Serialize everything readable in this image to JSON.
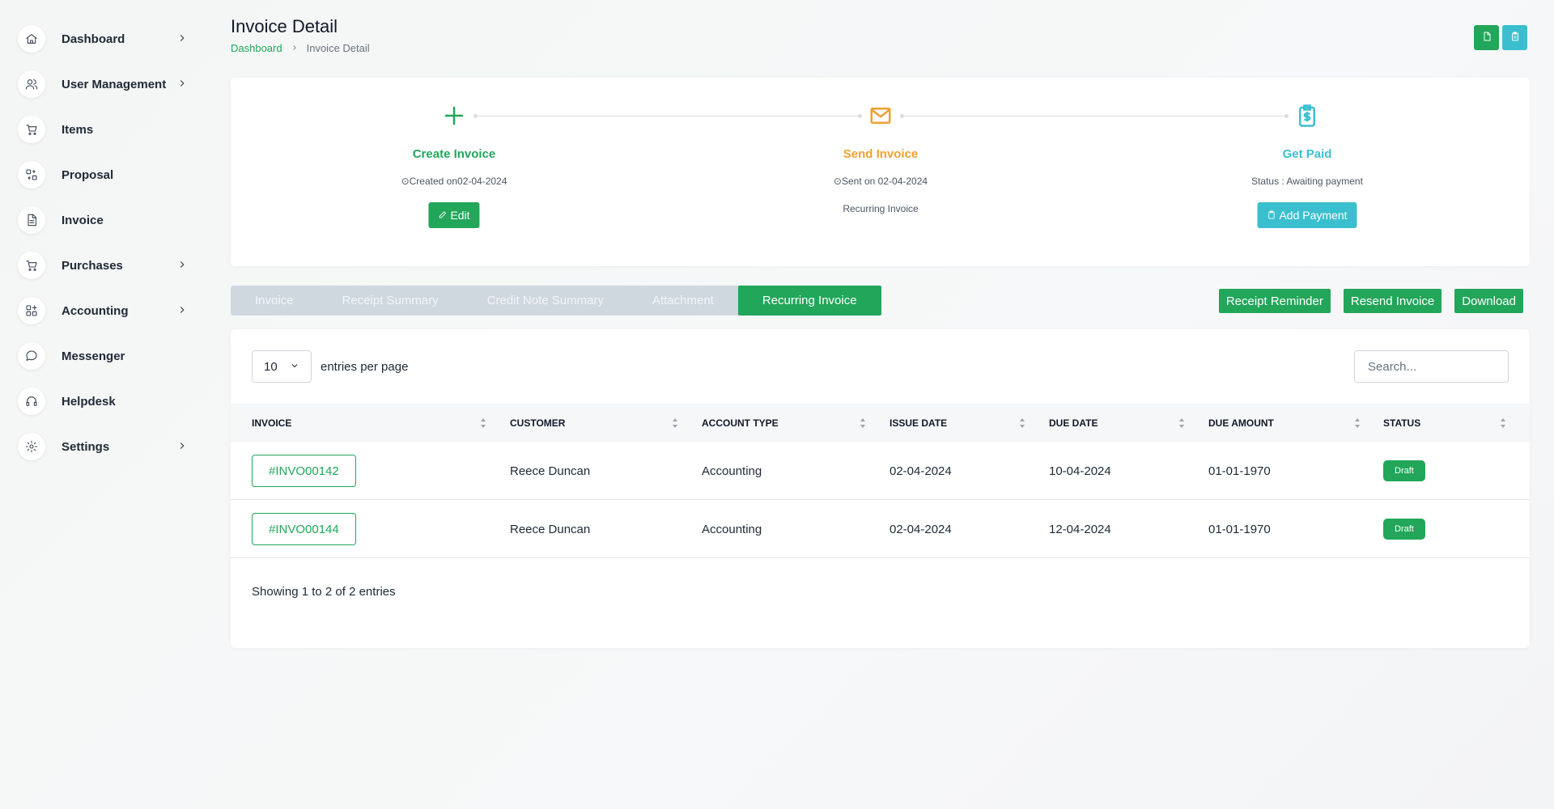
{
  "sidebar": {
    "items": [
      {
        "label": "Dashboard",
        "icon": "home-icon",
        "has_submenu": true
      },
      {
        "label": "User Management",
        "icon": "users-icon",
        "has_submenu": true
      },
      {
        "label": "Items",
        "icon": "cart-icon",
        "has_submenu": false
      },
      {
        "label": "Proposal",
        "icon": "proposal-icon",
        "has_submenu": false
      },
      {
        "label": "Invoice",
        "icon": "document-icon",
        "has_submenu": false
      },
      {
        "label": "Purchases",
        "icon": "cart-icon",
        "has_submenu": true
      },
      {
        "label": "Accounting",
        "icon": "grid-icon",
        "has_submenu": true
      },
      {
        "label": "Messenger",
        "icon": "chat-icon",
        "has_submenu": false
      },
      {
        "label": "Helpdesk",
        "icon": "headphones-icon",
        "has_submenu": false
      },
      {
        "label": "Settings",
        "icon": "gear-icon",
        "has_submenu": true
      }
    ]
  },
  "header": {
    "title": "Invoice Detail",
    "breadcrumb": {
      "home": "Dashboard",
      "current": "Invoice Detail"
    },
    "buttons": [
      {
        "icon": "file-icon",
        "color": "#22a65a"
      },
      {
        "icon": "clipboard-icon",
        "color": "#3bbfcf"
      }
    ]
  },
  "progress": {
    "create": {
      "title": "Create Invoice",
      "subtitle": "Created on02-04-2024",
      "button": "Edit",
      "color": "#22a65a"
    },
    "send": {
      "title": "Send Invoice",
      "subtitle": "Sent on 02-04-2024",
      "note": "Recurring Invoice",
      "color": "#f0a030"
    },
    "paid": {
      "title": "Get Paid",
      "subtitle": "Status : Awaiting payment",
      "button": "Add Payment",
      "color": "#3bbfcf"
    }
  },
  "tabs": [
    {
      "label": "Invoice",
      "active": false
    },
    {
      "label": "Receipt Summary",
      "active": false
    },
    {
      "label": "Credit Note Summary",
      "active": false
    },
    {
      "label": "Attachment",
      "active": false
    },
    {
      "label": "Recurring Invoice",
      "active": true
    }
  ],
  "actions": {
    "reminder": "Receipt Reminder",
    "resend": "Resend Invoice",
    "download": "Download"
  },
  "table": {
    "page_size": "10",
    "entries_label": "entries per page",
    "search_placeholder": "Search...",
    "columns": [
      "INVOICE",
      "CUSTOMER",
      "ACCOUNT TYPE",
      "ISSUE DATE",
      "DUE DATE",
      "DUE AMOUNT",
      "STATUS"
    ],
    "rows": [
      {
        "invoice": "#INVO00142",
        "customer": "Reece Duncan",
        "account_type": "Accounting",
        "issue_date": "02-04-2024",
        "due_date": "10-04-2024",
        "due_amount": "01-01-1970",
        "status": "Draft"
      },
      {
        "invoice": "#INVO00144",
        "customer": "Reece Duncan",
        "account_type": "Accounting",
        "issue_date": "02-04-2024",
        "due_date": "12-04-2024",
        "due_amount": "01-01-1970",
        "status": "Draft"
      }
    ],
    "footer": "Showing 1 to 2 of 2 entries"
  },
  "colors": {
    "accent": "#22a65a",
    "info": "#3bbfcf",
    "warning": "#f0a030"
  }
}
